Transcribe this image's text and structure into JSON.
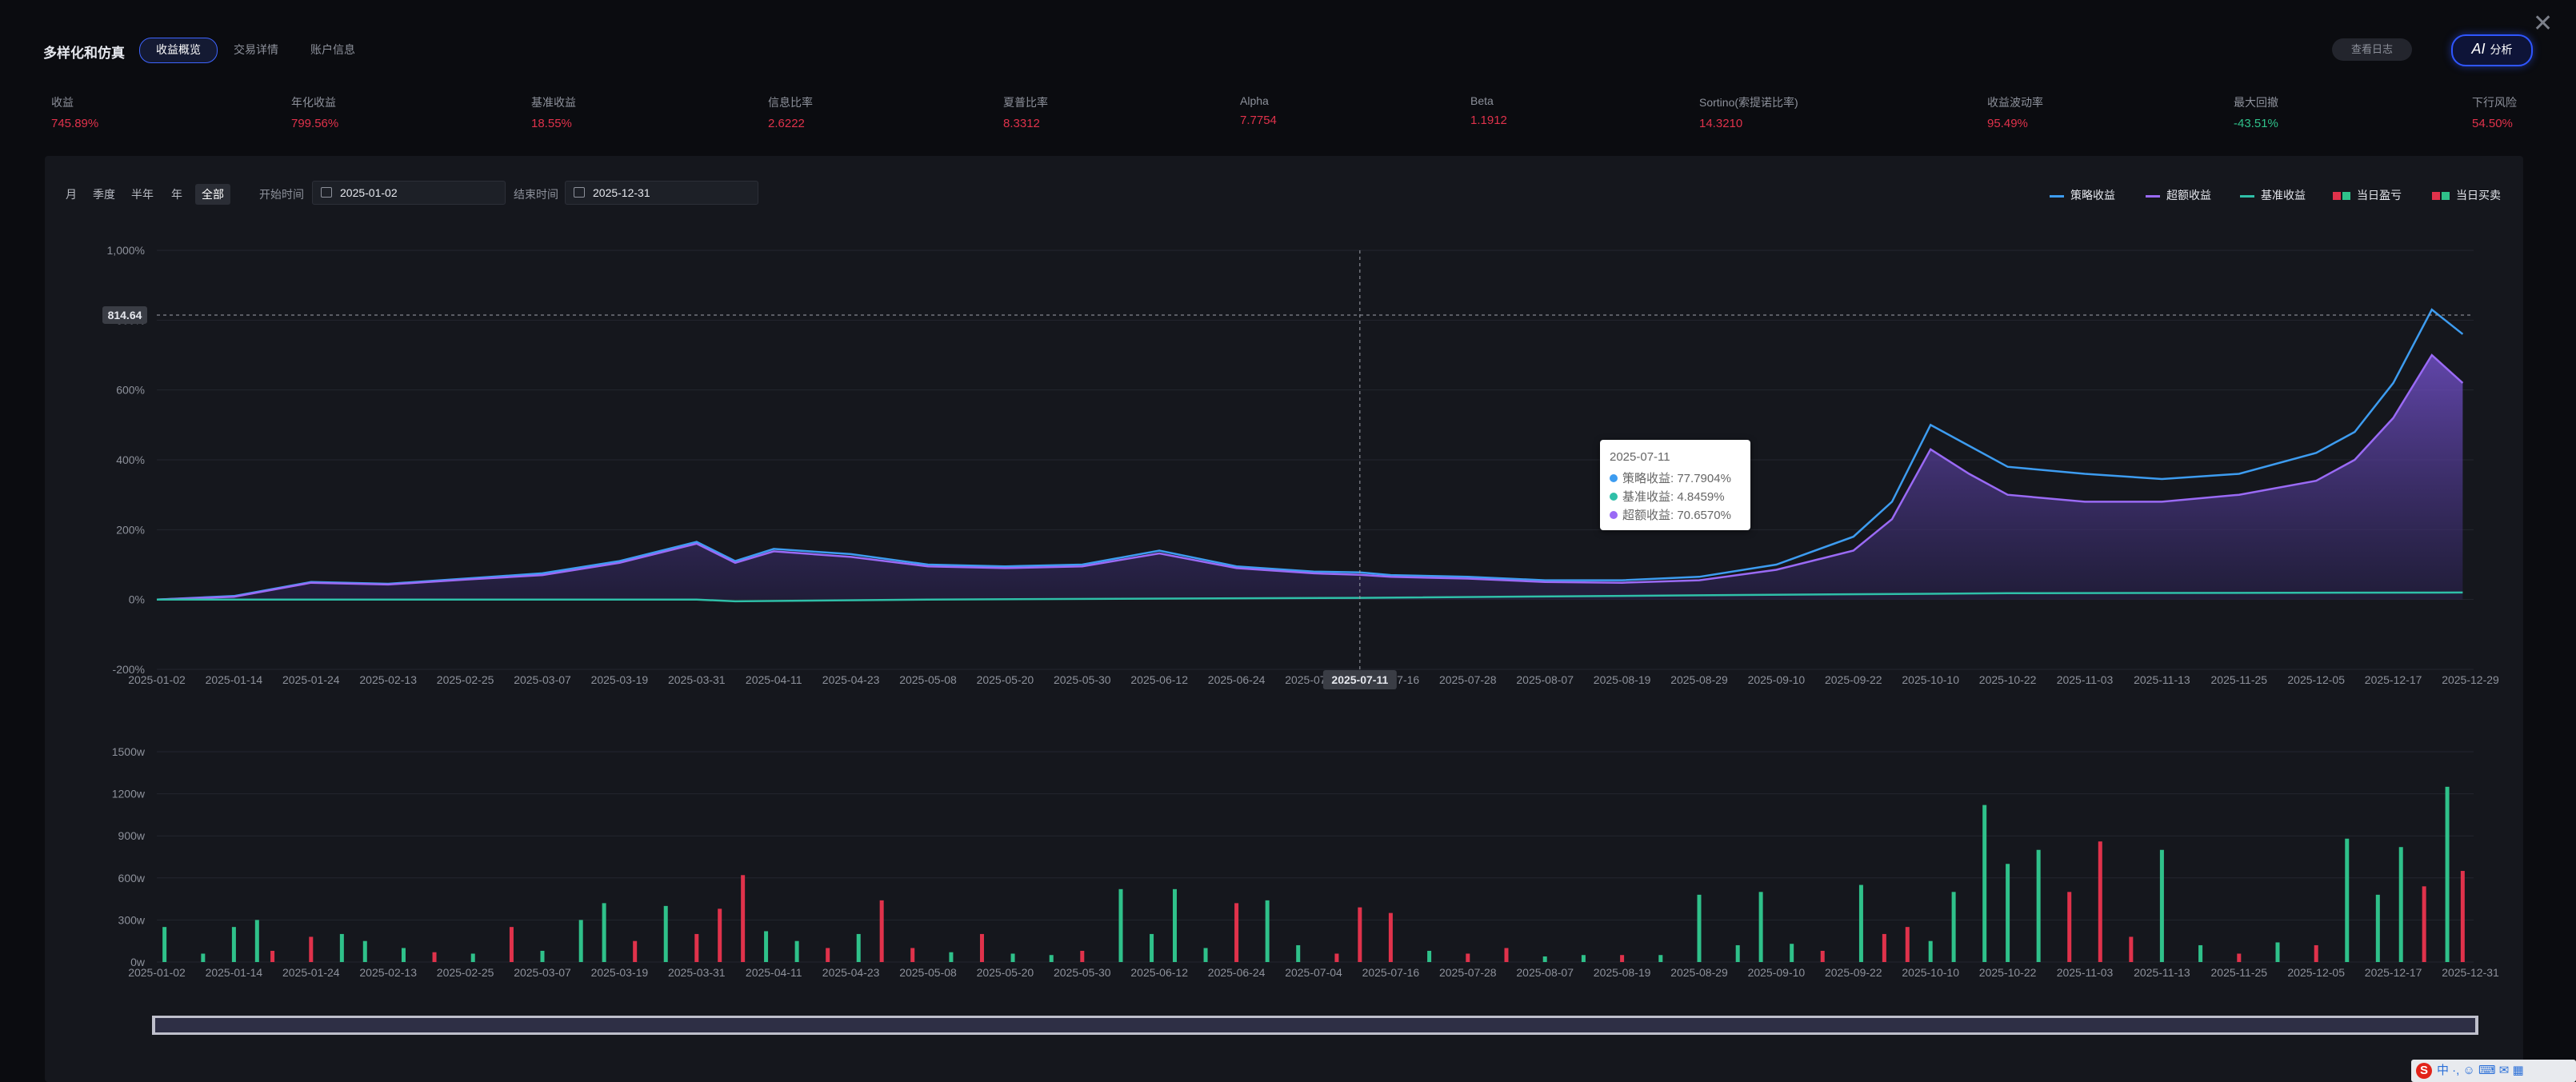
{
  "header": {
    "title": "多样化和仿真",
    "tabs": [
      "收益概览",
      "交易详情",
      "账户信息"
    ],
    "log_button": "查看日志",
    "ai_button_icon": "AI",
    "ai_button": "分析"
  },
  "metrics": [
    {
      "label": "收益",
      "value": "745.89%",
      "color": "#e0324b"
    },
    {
      "label": "年化收益",
      "value": "799.56%",
      "color": "#e0324b"
    },
    {
      "label": "基准收益",
      "value": "18.55%",
      "color": "#e0324b"
    },
    {
      "label": "信息比率",
      "value": "2.6222",
      "color": "#e0324b"
    },
    {
      "label": "夏普比率",
      "value": "8.3312",
      "color": "#e0324b"
    },
    {
      "label": "Alpha",
      "value": "7.7754",
      "color": "#e0324b"
    },
    {
      "label": "Beta",
      "value": "1.1912",
      "color": "#e0324b"
    },
    {
      "label": "Sortino(索提诺比率)",
      "value": "14.3210",
      "color": "#e0324b"
    },
    {
      "label": "收益波动率",
      "value": "95.49%",
      "color": "#e0324b"
    },
    {
      "label": "最大回撤",
      "value": "-43.51%",
      "color": "#2fc18a"
    },
    {
      "label": "下行风险",
      "value": "54.50%",
      "color": "#e0324b"
    }
  ],
  "filters": {
    "periods": [
      "月",
      "季度",
      "半年",
      "年",
      "全部"
    ],
    "start_label": "开始时间",
    "start_value": "2025-01-02",
    "end_label": "结束时间",
    "end_value": "2025-12-31"
  },
  "legend": [
    {
      "name": "策略收益",
      "color": "#3d9cf0",
      "kind": "line"
    },
    {
      "name": "超额收益",
      "color": "#9a6af5",
      "kind": "line"
    },
    {
      "name": "基准收益",
      "color": "#2fbfa8",
      "kind": "line"
    },
    {
      "name": "当日盈亏",
      "color": "#e0324b",
      "kind": "square",
      "color2": "#2fc18a"
    },
    {
      "name": "当日买卖",
      "color": "#e0324b",
      "kind": "square",
      "color2": "#2fc18a"
    }
  ],
  "crosshair": {
    "date": "2025-07-11",
    "y_label": "814.64"
  },
  "tooltip": {
    "date": "2025-07-11",
    "rows": [
      {
        "label": "策略收益:",
        "value": "77.7904%",
        "color": "#3d9cf0"
      },
      {
        "label": "基准收益:",
        "value": "4.8459%",
        "color": "#2fbfa8"
      },
      {
        "label": "超额收益:",
        "value": "70.6570%",
        "color": "#9a6af5"
      }
    ]
  },
  "chart_data": [
    {
      "type": "line",
      "y_ticks": [
        "1,000%",
        "800%",
        "600%",
        "400%",
        "200%",
        "0%",
        "-200%"
      ],
      "ylim": [
        -200,
        1000
      ],
      "x_ticks": [
        "2025-01-02",
        "2025-01-14",
        "2025-01-24",
        "2025-02-13",
        "2025-02-25",
        "2025-03-07",
        "2025-03-19",
        "2025-03-31",
        "2025-04-11",
        "2025-04-23",
        "2025-05-08",
        "2025-05-20",
        "2025-05-30",
        "2025-06-12",
        "2025-06-24",
        "2025-07-04",
        "2025-07-16",
        "2025-07-28",
        "2025-08-07",
        "2025-08-19",
        "2025-08-29",
        "2025-09-10",
        "2025-09-22",
        "2025-10-10",
        "2025-10-22",
        "2025-11-03",
        "2025-11-13",
        "2025-11-25",
        "2025-12-05",
        "2025-12-17",
        "2025-12-29"
      ],
      "series": [
        {
          "name": "策略收益",
          "points": [
            [
              0,
              0
            ],
            [
              1,
              10
            ],
            [
              2,
              50
            ],
            [
              3,
              45
            ],
            [
              4,
              60
            ],
            [
              5,
              75
            ],
            [
              6,
              110
            ],
            [
              7,
              165
            ],
            [
              7.5,
              110
            ],
            [
              8,
              145
            ],
            [
              9,
              130
            ],
            [
              10,
              100
            ],
            [
              11,
              95
            ],
            [
              12,
              100
            ],
            [
              13,
              140
            ],
            [
              14,
              95
            ],
            [
              15,
              80
            ],
            [
              15.6,
              77.8
            ],
            [
              16,
              70
            ],
            [
              17,
              65
            ],
            [
              18,
              55
            ],
            [
              19,
              55
            ],
            [
              20,
              65
            ],
            [
              21,
              100
            ],
            [
              22,
              180
            ],
            [
              22.5,
              280
            ],
            [
              23,
              500
            ],
            [
              23.5,
              440
            ],
            [
              24,
              380
            ],
            [
              25,
              360
            ],
            [
              26,
              345
            ],
            [
              27,
              360
            ],
            [
              28,
              420
            ],
            [
              28.5,
              480
            ],
            [
              29,
              620
            ],
            [
              29.5,
              830
            ],
            [
              29.9,
              760
            ]
          ]
        },
        {
          "name": "超额收益",
          "points": [
            [
              0,
              0
            ],
            [
              1,
              8
            ],
            [
              2,
              48
            ],
            [
              3,
              43
            ],
            [
              4,
              57
            ],
            [
              5,
              70
            ],
            [
              6,
              105
            ],
            [
              7,
              160
            ],
            [
              7.5,
              105
            ],
            [
              8,
              138
            ],
            [
              9,
              122
            ],
            [
              10,
              95
            ],
            [
              11,
              90
            ],
            [
              12,
              95
            ],
            [
              13,
              132
            ],
            [
              14,
              90
            ],
            [
              15,
              75
            ],
            [
              15.6,
              70.7
            ],
            [
              16,
              65
            ],
            [
              17,
              60
            ],
            [
              18,
              50
            ],
            [
              19,
              48
            ],
            [
              20,
              55
            ],
            [
              21,
              85
            ],
            [
              22,
              140
            ],
            [
              22.5,
              230
            ],
            [
              23,
              430
            ],
            [
              23.5,
              360
            ],
            [
              24,
              300
            ],
            [
              25,
              280
            ],
            [
              26,
              280
            ],
            [
              27,
              300
            ],
            [
              28,
              340
            ],
            [
              28.5,
              400
            ],
            [
              29,
              520
            ],
            [
              29.5,
              700
            ],
            [
              29.9,
              620
            ]
          ]
        },
        {
          "name": "基准收益",
          "points": [
            [
              0,
              0
            ],
            [
              7,
              0
            ],
            [
              7.5,
              -5
            ],
            [
              10,
              0
            ],
            [
              15.6,
              4.8
            ],
            [
              20,
              12
            ],
            [
              24,
              18
            ],
            [
              29.9,
              20
            ]
          ]
        }
      ]
    },
    {
      "type": "bar",
      "y_ticks": [
        "1500w",
        "1200w",
        "900w",
        "600w",
        "300w",
        "0w"
      ],
      "ylim": [
        0,
        1500
      ],
      "x_ticks": [
        "2025-01-02",
        "2025-01-14",
        "2025-01-24",
        "2025-02-13",
        "2025-02-25",
        "2025-03-07",
        "2025-03-19",
        "2025-03-31",
        "2025-04-11",
        "2025-04-23",
        "2025-05-08",
        "2025-05-20",
        "2025-05-30",
        "2025-06-12",
        "2025-06-24",
        "2025-07-04",
        "2025-07-16",
        "2025-07-28",
        "2025-08-07",
        "2025-08-19",
        "2025-08-29",
        "2025-09-10",
        "2025-09-22",
        "2025-10-10",
        "2025-10-22",
        "2025-11-03",
        "2025-11-13",
        "2025-11-25",
        "2025-12-05",
        "2025-12-17",
        "2025-12-31"
      ],
      "bars": [
        {
          "x": 0.1,
          "v": 250,
          "c": "g"
        },
        {
          "x": 0.6,
          "v": 60,
          "c": "g"
        },
        {
          "x": 1.0,
          "v": 250,
          "c": "g"
        },
        {
          "x": 1.3,
          "v": 300,
          "c": "g"
        },
        {
          "x": 1.5,
          "v": 80,
          "c": "r"
        },
        {
          "x": 2.0,
          "v": 180,
          "c": "r"
        },
        {
          "x": 2.4,
          "v": 200,
          "c": "g"
        },
        {
          "x": 2.7,
          "v": 150,
          "c": "g"
        },
        {
          "x": 3.2,
          "v": 100,
          "c": "g"
        },
        {
          "x": 3.6,
          "v": 70,
          "c": "r"
        },
        {
          "x": 4.1,
          "v": 60,
          "c": "g"
        },
        {
          "x": 4.6,
          "v": 250,
          "c": "r"
        },
        {
          "x": 5.0,
          "v": 80,
          "c": "g"
        },
        {
          "x": 5.5,
          "v": 300,
          "c": "g"
        },
        {
          "x": 5.8,
          "v": 420,
          "c": "g"
        },
        {
          "x": 6.2,
          "v": 150,
          "c": "r"
        },
        {
          "x": 6.6,
          "v": 400,
          "c": "g"
        },
        {
          "x": 7.0,
          "v": 200,
          "c": "r"
        },
        {
          "x": 7.3,
          "v": 380,
          "c": "r"
        },
        {
          "x": 7.6,
          "v": 620,
          "c": "r"
        },
        {
          "x": 7.9,
          "v": 220,
          "c": "g"
        },
        {
          "x": 8.3,
          "v": 150,
          "c": "g"
        },
        {
          "x": 8.7,
          "v": 100,
          "c": "r"
        },
        {
          "x": 9.1,
          "v": 200,
          "c": "g"
        },
        {
          "x": 9.4,
          "v": 440,
          "c": "r"
        },
        {
          "x": 9.8,
          "v": 100,
          "c": "r"
        },
        {
          "x": 10.3,
          "v": 70,
          "c": "g"
        },
        {
          "x": 10.7,
          "v": 200,
          "c": "r"
        },
        {
          "x": 11.1,
          "v": 60,
          "c": "g"
        },
        {
          "x": 11.6,
          "v": 50,
          "c": "g"
        },
        {
          "x": 12.0,
          "v": 80,
          "c": "r"
        },
        {
          "x": 12.5,
          "v": 520,
          "c": "g"
        },
        {
          "x": 12.9,
          "v": 200,
          "c": "g"
        },
        {
          "x": 13.2,
          "v": 520,
          "c": "g"
        },
        {
          "x": 13.6,
          "v": 100,
          "c": "g"
        },
        {
          "x": 14.0,
          "v": 420,
          "c": "r"
        },
        {
          "x": 14.4,
          "v": 440,
          "c": "g"
        },
        {
          "x": 14.8,
          "v": 120,
          "c": "g"
        },
        {
          "x": 15.3,
          "v": 60,
          "c": "r"
        },
        {
          "x": 15.6,
          "v": 390,
          "c": "r"
        },
        {
          "x": 16.0,
          "v": 350,
          "c": "r"
        },
        {
          "x": 16.5,
          "v": 80,
          "c": "g"
        },
        {
          "x": 17.0,
          "v": 60,
          "c": "r"
        },
        {
          "x": 17.5,
          "v": 100,
          "c": "r"
        },
        {
          "x": 18.0,
          "v": 40,
          "c": "g"
        },
        {
          "x": 18.5,
          "v": 50,
          "c": "g"
        },
        {
          "x": 19.0,
          "v": 50,
          "c": "r"
        },
        {
          "x": 19.5,
          "v": 50,
          "c": "g"
        },
        {
          "x": 20.0,
          "v": 480,
          "c": "g"
        },
        {
          "x": 20.5,
          "v": 120,
          "c": "g"
        },
        {
          "x": 20.8,
          "v": 500,
          "c": "g"
        },
        {
          "x": 21.2,
          "v": 130,
          "c": "g"
        },
        {
          "x": 21.6,
          "v": 80,
          "c": "r"
        },
        {
          "x": 22.1,
          "v": 550,
          "c": "g"
        },
        {
          "x": 22.4,
          "v": 200,
          "c": "r"
        },
        {
          "x": 22.7,
          "v": 250,
          "c": "r"
        },
        {
          "x": 23.0,
          "v": 150,
          "c": "g"
        },
        {
          "x": 23.3,
          "v": 500,
          "c": "g"
        },
        {
          "x": 23.7,
          "v": 1120,
          "c": "g"
        },
        {
          "x": 24.0,
          "v": 700,
          "c": "g"
        },
        {
          "x": 24.4,
          "v": 800,
          "c": "g"
        },
        {
          "x": 24.8,
          "v": 500,
          "c": "r"
        },
        {
          "x": 25.2,
          "v": 860,
          "c": "r"
        },
        {
          "x": 25.6,
          "v": 180,
          "c": "r"
        },
        {
          "x": 26.0,
          "v": 800,
          "c": "g"
        },
        {
          "x": 26.5,
          "v": 120,
          "c": "g"
        },
        {
          "x": 27.0,
          "v": 60,
          "c": "r"
        },
        {
          "x": 27.5,
          "v": 140,
          "c": "g"
        },
        {
          "x": 28.0,
          "v": 120,
          "c": "r"
        },
        {
          "x": 28.4,
          "v": 880,
          "c": "g"
        },
        {
          "x": 28.8,
          "v": 480,
          "c": "g"
        },
        {
          "x": 29.1,
          "v": 820,
          "c": "g"
        },
        {
          "x": 29.4,
          "v": 540,
          "c": "r"
        },
        {
          "x": 29.7,
          "v": 1250,
          "c": "g"
        },
        {
          "x": 29.9,
          "v": 650,
          "c": "r"
        }
      ]
    }
  ]
}
